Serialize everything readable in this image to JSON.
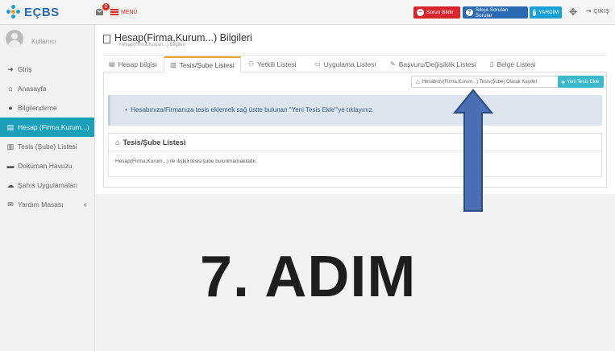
{
  "header": {
    "logo_text": "EÇBS",
    "notification_count": "0",
    "menu_label": "MENÜ",
    "buttons": {
      "report": "Sorun Bildir",
      "faq": "Sıkça Sorulan Sorular",
      "help": "YARDIM"
    },
    "logout_label": "ÇIKIŞ"
  },
  "sidebar": {
    "username": "Kullanıcı",
    "items": [
      {
        "label": "Giriş",
        "icon": "sign-in-icon"
      },
      {
        "label": "Anasayfa",
        "icon": "home-icon"
      },
      {
        "label": "Bilgilendirme",
        "icon": "info-icon"
      },
      {
        "label": "Hesap (Firma,Kurum...)",
        "icon": "document-icon"
      },
      {
        "label": "Tesis (Şube) Listesi",
        "icon": "building-icon"
      },
      {
        "label": "Doküman Havuzu",
        "icon": "inbox-icon"
      },
      {
        "label": "Şahıs Uygulamaları",
        "icon": "cloud-icon"
      },
      {
        "label": "Yardım Masası",
        "icon": "envelope-icon"
      }
    ]
  },
  "page": {
    "title": "Hesap(Firma,Kurum...) Bilgileri",
    "subtitle": "Hesap(Firma,Kurum...) Bilgileri"
  },
  "tabs": [
    {
      "label": "Hesap bilgisi"
    },
    {
      "label": "Tesis/Şube Listesi"
    },
    {
      "label": "Yetkili Listesi"
    },
    {
      "label": "Uygulama Listesi"
    },
    {
      "label": "Başvuru/Değişiklik Listesi"
    },
    {
      "label": "Belge Listesi"
    }
  ],
  "actions": {
    "save_label": "Hesabımı(Firma,Kurum...) Tesis(Şube) Olarak Kaydet",
    "new_label": "Yeni Tesis Ekle"
  },
  "info_text": "Hesabınıza/Firmanıza tesis eklemek sağ üstte bulunan \"Yeni Tesis Ekle\"'ye tıklayınız.",
  "list": {
    "title": "Tesis/Şube Listesi",
    "empty_text": "Hesap(Firma,Kurum...) ile ilişkili tesis/şube bulunmamaktadır."
  },
  "overlay": {
    "step_text": "7. ADIM",
    "arrow_color": "#4a6fb5"
  },
  "colors": {
    "accent": "#1aa0b8",
    "report_red": "#d9262c",
    "faq_blue": "#2a6ab3",
    "help_cyan": "#1aa0d8",
    "new_button": "#3cb8c8",
    "tab_active_border": "#f0a020"
  }
}
